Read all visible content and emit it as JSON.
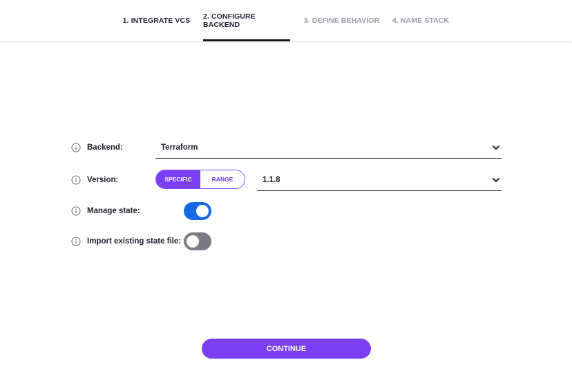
{
  "stepper": {
    "steps": [
      {
        "label": "1. INTEGRATE VCS",
        "state": "completed"
      },
      {
        "label": "2. CONFIGURE BACKEND",
        "state": "active"
      },
      {
        "label": "3. DEFINE BEHAVIOR",
        "state": "inactive"
      },
      {
        "label": "4. NAME STACK",
        "state": "inactive"
      }
    ]
  },
  "form": {
    "backend": {
      "label": "Backend:",
      "value": "Terraform",
      "icon": "info-icon"
    },
    "version": {
      "label": "Version:",
      "icon": "info-icon",
      "modes": [
        "SPECIFIC",
        "RANGE"
      ],
      "selected_mode": "SPECIFIC",
      "value": "1.1.8"
    },
    "manage_state": {
      "label": "Manage state:",
      "enabled": true,
      "icon": "info-icon"
    },
    "import_state": {
      "label": "Import existing state file:",
      "enabled": false,
      "icon": "info-icon"
    }
  },
  "continue_label": "CONTINUE",
  "colors": {
    "accent": "#7b3ff2",
    "toggle_on": "#1668e3",
    "toggle_off": "#7a7a85",
    "active_step_underline": "#16161f"
  }
}
